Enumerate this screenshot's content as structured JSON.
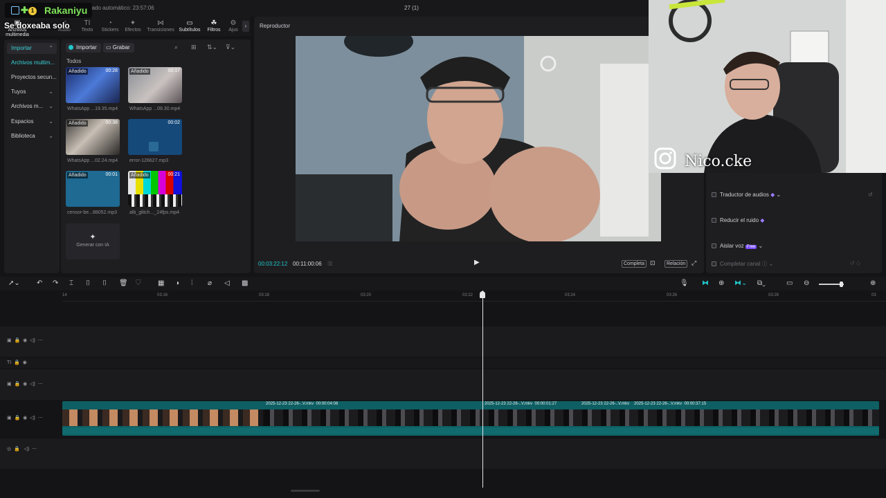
{
  "titlebar": {
    "autosave": "dado automático: 23:57:06",
    "project_title": "27 (1)"
  },
  "overlay": {
    "streamer_name": "Rakaniyu",
    "level_badge": "1",
    "caption": "Se doxeaba solo",
    "social_handle": "Nico.cke"
  },
  "tools": [
    {
      "label": "Archivos multimedia",
      "icon": "media-icon"
    },
    {
      "label": "Audio",
      "icon": "music-icon"
    },
    {
      "label": "Texto",
      "icon": "text-icon",
      "glyph": "TI"
    },
    {
      "label": "Stickers",
      "icon": "sticker-icon"
    },
    {
      "label": "Efectos",
      "icon": "effects-icon"
    },
    {
      "label": "Transiciones",
      "icon": "transition-icon"
    },
    {
      "label": "Subtítulos",
      "icon": "subtitles-icon"
    },
    {
      "label": "Filtros",
      "icon": "filters-icon"
    },
    {
      "label": "Ajus",
      "icon": "adjust-icon"
    }
  ],
  "leftnav": {
    "import": "Importar",
    "items": [
      "Archivos multim...",
      "Proyectos secun...",
      "Tuyos",
      "Archivos m...",
      "Espacios",
      "Biblioteca"
    ]
  },
  "media": {
    "import_button": "Importar",
    "record_button": "Grabar",
    "section_label": "Todos",
    "clips": [
      {
        "badge": "Añadido",
        "duration": "00:28",
        "name": "WhatsApp ...19.35.mp4"
      },
      {
        "badge": "Añadido",
        "duration": "00:17",
        "name": "WhatsApp ...09.30.mp4"
      },
      {
        "badge": "Añadido",
        "duration": "00:38",
        "name": "WhatsApp ...02.24.mp4"
      },
      {
        "badge": "",
        "duration": "00:02",
        "name": "error-126627.mp3"
      },
      {
        "badge": "Añadido",
        "duration": "00:01",
        "name": "censor-be...88052.mp3"
      },
      {
        "badge": "Añadido",
        "duration": "00:21",
        "name": "alb_glitch..._24fps.mp4"
      }
    ],
    "generate_label": "Generar con IA"
  },
  "player": {
    "title": "Reproductor",
    "current_time": "00:03:22:12",
    "total_time": "00:11:00:06",
    "full_button": "Completa",
    "ratio_button": "Relación"
  },
  "right_panel": {
    "items": [
      {
        "label": "Traductor de audios"
      },
      {
        "label": "Reducir el ruido"
      },
      {
        "label": "Aislar voz",
        "badge": "Free"
      },
      {
        "label": "Completar canal"
      }
    ]
  },
  "ruler_ticks": [
    "14",
    "03:16",
    "03:18",
    "03:20",
    "03:22",
    "03:24",
    "03:26",
    "03:28",
    "03"
  ],
  "main_track": {
    "segments": [
      {
        "label": "2025-12-23 22-26-..V.mkv",
        "duration": "00:00:04:08"
      },
      {
        "label": "2025-12-23 22-26-..V.mkv",
        "duration": "00:00:01:27"
      },
      {
        "label": "2025-12-23 22-26-..V.mkv",
        "duration": ""
      },
      {
        "label": "2025-12-23 22-26-..V.mkv",
        "duration": "00:00:37:15"
      }
    ]
  },
  "colors": {
    "accent": "#20c7c9",
    "track": "#0e5f63",
    "panel": "#1e1e21",
    "background": "#141416"
  }
}
